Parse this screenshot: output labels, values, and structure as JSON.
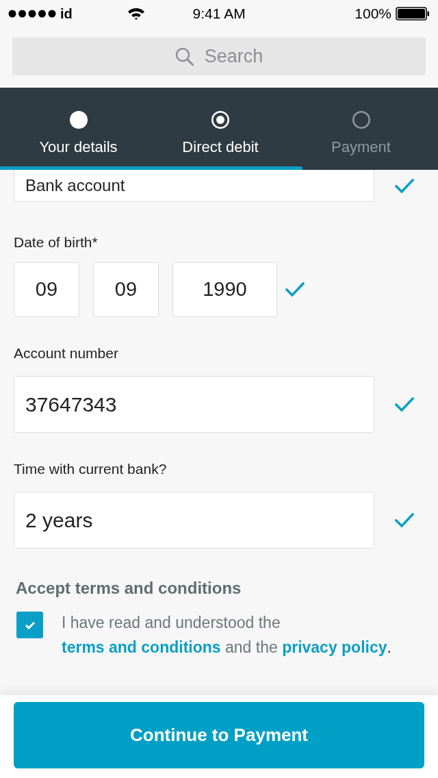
{
  "status_bar": {
    "carrier": "id",
    "time": "9:41 AM",
    "battery": "100%"
  },
  "search": {
    "placeholder": "Search"
  },
  "steps": [
    {
      "label": "Your details",
      "completed": true,
      "selected": false
    },
    {
      "label": "Direct debit",
      "completed": false,
      "selected": true
    },
    {
      "label": "Payment",
      "completed": false,
      "selected": false
    }
  ],
  "progress": {
    "level": 0.69
  },
  "form": [
    {
      "kind": "text",
      "value": "Bank account",
      "valid": true
    },
    {
      "kind": "date",
      "label": "Date of birth*",
      "parts": [
        "09",
        "09",
        "1990"
      ],
      "valid": true
    },
    {
      "kind": "text",
      "label": "Account number",
      "value": "37647343",
      "valid": true
    },
    {
      "kind": "text",
      "label": "Time with current bank?",
      "value": "2 years",
      "valid": true
    }
  ],
  "terms": {
    "heading": "Accept terms and conditions",
    "checked": true,
    "parts": [
      {
        "kind": "text",
        "text": "I have read and understood the "
      },
      {
        "kind": "link",
        "text": "terms and conditions"
      },
      {
        "kind": "text",
        "text": " and the "
      },
      {
        "kind": "link",
        "text": "privacy policy"
      },
      {
        "kind": "end",
        "text": "."
      }
    ]
  },
  "button": {
    "label": "Continue to Payment"
  }
}
